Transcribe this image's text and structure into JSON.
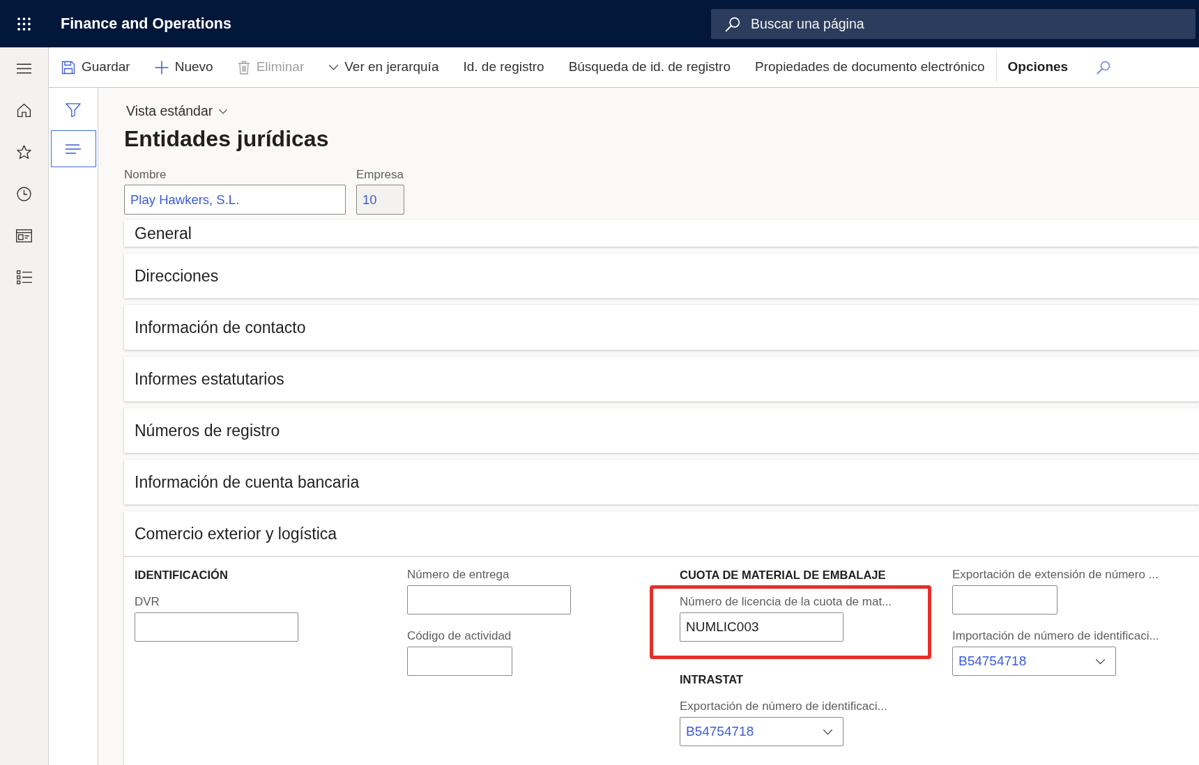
{
  "app_bar": {
    "title": "Finance and Operations",
    "search": {
      "placeholder": "Buscar una página"
    }
  },
  "action_pane": {
    "items": [
      {
        "kind": "save",
        "label": "Guardar",
        "disabled": false
      },
      {
        "kind": "add",
        "label": "Nuevo",
        "disabled": false
      },
      {
        "kind": "delete",
        "label": "Eliminar",
        "disabled": true
      },
      {
        "kind": "dropdown",
        "label": "Ver en jerarquía",
        "disabled": false
      },
      {
        "kind": "plain",
        "label": "Id. de registro",
        "disabled": false
      },
      {
        "kind": "plain",
        "label": "Búsqueda de id. de registro",
        "disabled": false
      },
      {
        "kind": "plain",
        "label": "Propiedades de documento electrónico",
        "disabled": false
      },
      {
        "kind": "tab",
        "label": "Opciones",
        "disabled": false
      },
      {
        "kind": "search",
        "disabled": false
      }
    ]
  },
  "side_pane": {
    "buttons": [
      {
        "kind": "filter",
        "selected": false
      },
      {
        "kind": "details",
        "selected": true
      }
    ]
  },
  "page": {
    "view_selector": "Vista estándar",
    "title": "Entidades jurídicas",
    "header_fields": [
      {
        "label": "Nombre",
        "value": "Play Hawkers, S.L.",
        "read_only": false
      },
      {
        "label": "Empresa",
        "value": "10",
        "read_only": true
      }
    ]
  },
  "sections": [
    {
      "title": "General",
      "expanded": false
    },
    {
      "title": "Direcciones",
      "expanded": false
    },
    {
      "title": "Información de contacto",
      "expanded": false
    },
    {
      "title": "Informes estatutarios",
      "expanded": false
    },
    {
      "title": "Números de registro",
      "expanded": false
    },
    {
      "title": "Información de cuenta bancaria",
      "expanded": false
    },
    {
      "title": "Comercio exterior y logística",
      "expanded": true,
      "columns": [
        {
          "items": [
            {
              "kind": "heading",
              "text": "IDENTIFICACIÓN"
            },
            {
              "kind": "field",
              "label": "DVR",
              "highlighted": false
            }
          ]
        },
        {
          "items": [
            {
              "kind": "field",
              "label": "Número de entrega",
              "highlighted": false
            },
            {
              "kind": "shortfield",
              "label": "Código de actividad",
              "highlighted": false
            }
          ]
        },
        {
          "items": [
            {
              "kind": "heading",
              "text": "CUOTA DE MATERIAL DE EMBALAJE"
            },
            {
              "kind": "field",
              "label": "Número de licencia de la cuota de mat...",
              "value": "NUMLIC003",
              "highlighted": true
            },
            {
              "kind": "heading",
              "text": "INTRASTAT"
            },
            {
              "kind": "select",
              "label": "Exportación de número de identificaci...",
              "value": "B54754718",
              "highlighted": false
            }
          ]
        },
        {
          "items": [
            {
              "kind": "shortfield",
              "label": "Exportación de extensión de número ...",
              "highlighted": false
            },
            {
              "kind": "select",
              "label": "Importación de número de identificaci...",
              "value": "B54754718",
              "highlighted": false
            }
          ]
        }
      ]
    }
  ]
}
